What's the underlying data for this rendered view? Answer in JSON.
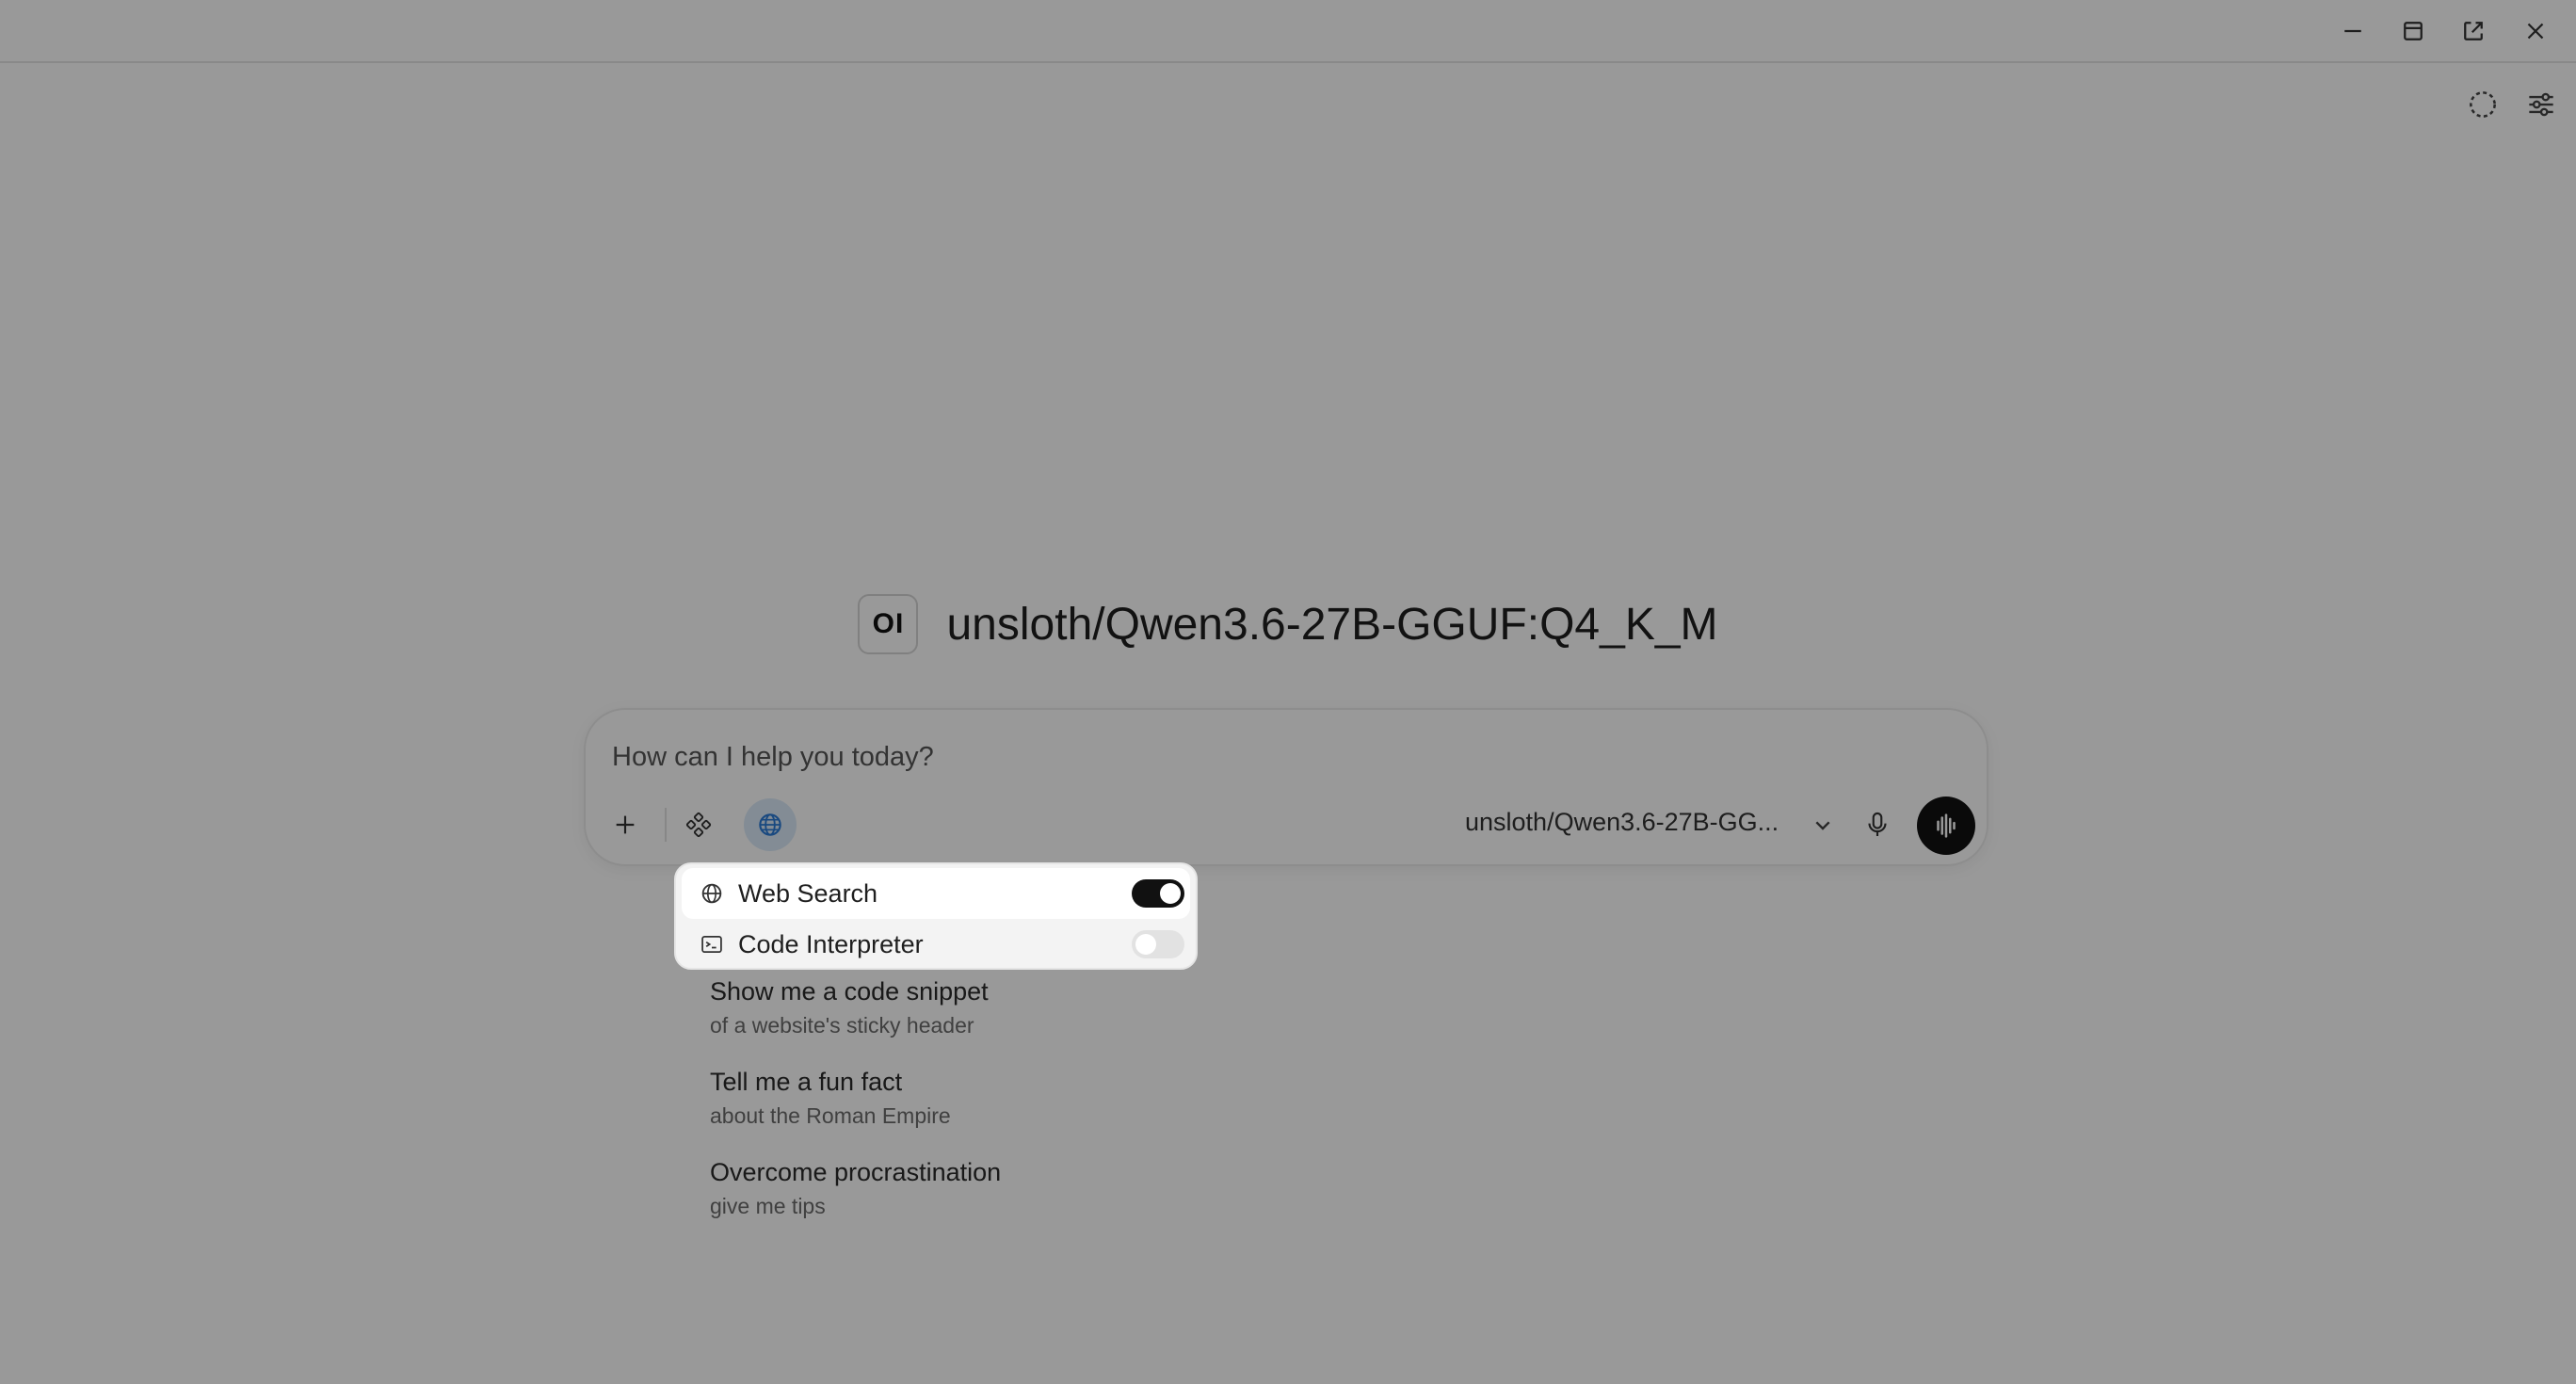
{
  "window": {
    "controls": [
      {
        "name": "minimize-icon"
      },
      {
        "name": "restore-icon"
      },
      {
        "name": "popout-icon"
      },
      {
        "name": "close-icon"
      }
    ]
  },
  "toolbar": {
    "icons": [
      "loading-circle-icon",
      "settings-sliders-icon"
    ]
  },
  "model": {
    "logo_text": "OI",
    "title": "unsloth/Qwen3.6-27B-GGUF:Q4_K_M"
  },
  "chat": {
    "placeholder": "How can I help you today?",
    "model_select": "unsloth/Qwen3.6-27B-GG...",
    "tools": [
      "plus-icon",
      "integrations-icon",
      "globe-icon"
    ]
  },
  "tools_menu": {
    "items": [
      {
        "label": "Web Search",
        "icon": "globe-icon",
        "enabled": true
      },
      {
        "label": "Code Interpreter",
        "icon": "terminal-icon",
        "enabled": false
      }
    ]
  },
  "suggestions": [
    {
      "title": "Show me a code snippet",
      "subtitle": "of a website's sticky header"
    },
    {
      "title": "Tell me a fun fact",
      "subtitle": "about the Roman Empire"
    },
    {
      "title": "Overcome procrastination",
      "subtitle": "give me tips"
    }
  ],
  "colors": {
    "scrim": "#000000",
    "accent": "#2b7bd6",
    "toggle_on": "#111111",
    "toggle_off": "#e2e2e2"
  }
}
